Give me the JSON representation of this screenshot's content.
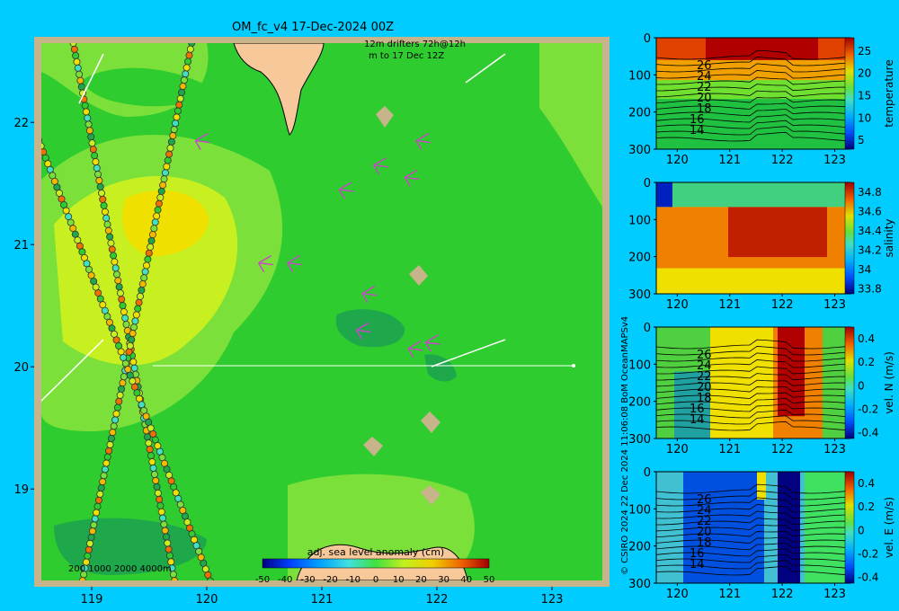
{
  "header": {
    "title": "OM_fc_v4  17-Dec-2024 00Z",
    "drifter_note_line1": "12m   drifters 72h@12h",
    "drifter_note_line2": "m        to 17 Dec 12Z"
  },
  "copyright": "© CSIRO 2024   22 Dec 2024 11:06:08 BoM OceanMAPSv4",
  "colors": {
    "page_bg": "#00ccff",
    "map_frame": "#c8b48a",
    "land": "#f7c99a",
    "green": "#2ecc2e",
    "dark_green": "#1fa84b",
    "light_green": "#7ce03a",
    "yellow_green": "#c8f020",
    "yellow": "#f0e000",
    "orange": "#f5b800",
    "drifter": "#cc44cc"
  },
  "chart_data": [
    {
      "type": "heatmap",
      "name": "map",
      "title": "",
      "xlabel": "",
      "ylabel": "",
      "x_ticks": [
        "119",
        "120",
        "121",
        "122",
        "123"
      ],
      "y_ticks": [
        "19",
        "20",
        "21",
        "22"
      ],
      "xlim": [
        118.5,
        123.5
      ],
      "ylim": [
        18.2,
        22.7
      ],
      "depth_legend": "200  1000  2000  4000m",
      "colorbar": {
        "label": "adj. sea level anomaly (cm)",
        "ticks": [
          "-50",
          "-40",
          "-30",
          "-20",
          "-10",
          "0",
          "10",
          "20",
          "30",
          "40",
          "50"
        ],
        "range": [
          -50,
          50
        ]
      },
      "tracks": [
        {
          "from": [
            118.83,
            22.7
          ],
          "to": [
            119.72,
            18.25
          ]
        },
        {
          "from": [
            119.88,
            22.7
          ],
          "to": [
            118.92,
            18.25
          ]
        },
        {
          "from": [
            118.5,
            21.95
          ],
          "to": [
            120.05,
            18.2
          ]
        }
      ],
      "drifters": [
        {
          "lon": 119.9,
          "lat": 21.85
        },
        {
          "lon": 121.82,
          "lat": 21.85
        },
        {
          "lon": 121.72,
          "lat": 21.55
        },
        {
          "lon": 121.45,
          "lat": 21.65
        },
        {
          "lon": 121.15,
          "lat": 21.45
        },
        {
          "lon": 120.7,
          "lat": 20.85
        },
        {
          "lon": 120.45,
          "lat": 20.85
        },
        {
          "lon": 121.35,
          "lat": 20.6
        },
        {
          "lon": 121.3,
          "lat": 20.3
        },
        {
          "lon": 121.9,
          "lat": 20.2
        },
        {
          "lon": 121.75,
          "lat": 20.15
        }
      ]
    },
    {
      "type": "heatmap",
      "name": "temperature",
      "ylabel_right": "temperature",
      "x_ticks": [
        "120",
        "121",
        "122",
        "123"
      ],
      "xlim": [
        119.6,
        123.3
      ],
      "y_ticks": [
        "0",
        "100",
        "200",
        "300"
      ],
      "ylim": [
        300,
        0
      ],
      "colorbar_ticks": [
        "5",
        "10",
        "15",
        "20",
        "25"
      ],
      "colorbar_range": [
        3,
        28
      ],
      "contour_labels": [
        "26",
        "24",
        "22",
        "20",
        "18",
        "16",
        "14"
      ]
    },
    {
      "type": "heatmap",
      "name": "salinity",
      "ylabel_right": "salinity",
      "x_ticks": [
        "120",
        "121",
        "122",
        "123"
      ],
      "xlim": [
        119.6,
        123.3
      ],
      "y_ticks": [
        "0",
        "100",
        "200",
        "300"
      ],
      "ylim": [
        300,
        0
      ],
      "colorbar_ticks": [
        "33.8",
        "34",
        "34.2",
        "34.4",
        "34.6",
        "34.8"
      ],
      "colorbar_range": [
        33.75,
        34.9
      ],
      "contour_labels": []
    },
    {
      "type": "heatmap",
      "name": "vel_N",
      "ylabel_right": "vel. N (m/s)",
      "x_ticks": [
        "120",
        "121",
        "122",
        "123"
      ],
      "xlim": [
        119.6,
        123.3
      ],
      "y_ticks": [
        "0",
        "100",
        "200",
        "300"
      ],
      "ylim": [
        300,
        0
      ],
      "colorbar_ticks": [
        "-0.4",
        "-0.2",
        "0",
        "0.2",
        "0.4"
      ],
      "colorbar_range": [
        -0.45,
        0.5
      ],
      "contour_labels": [
        "26",
        "24",
        "22",
        "20",
        "18",
        "16",
        "14"
      ]
    },
    {
      "type": "heatmap",
      "name": "vel_E",
      "ylabel_right": "vel. E (m/s)",
      "x_ticks": [
        "120",
        "121",
        "122",
        "123"
      ],
      "xlim": [
        119.6,
        123.3
      ],
      "y_ticks": [
        "0",
        "100",
        "200",
        "300"
      ],
      "ylim": [
        300,
        0
      ],
      "colorbar_ticks": [
        "-0.4",
        "-0.2",
        "0",
        "0.2",
        "0.4"
      ],
      "colorbar_range": [
        -0.45,
        0.5
      ],
      "contour_labels": [
        "26",
        "24",
        "22",
        "20",
        "18",
        "16",
        "14"
      ]
    }
  ]
}
